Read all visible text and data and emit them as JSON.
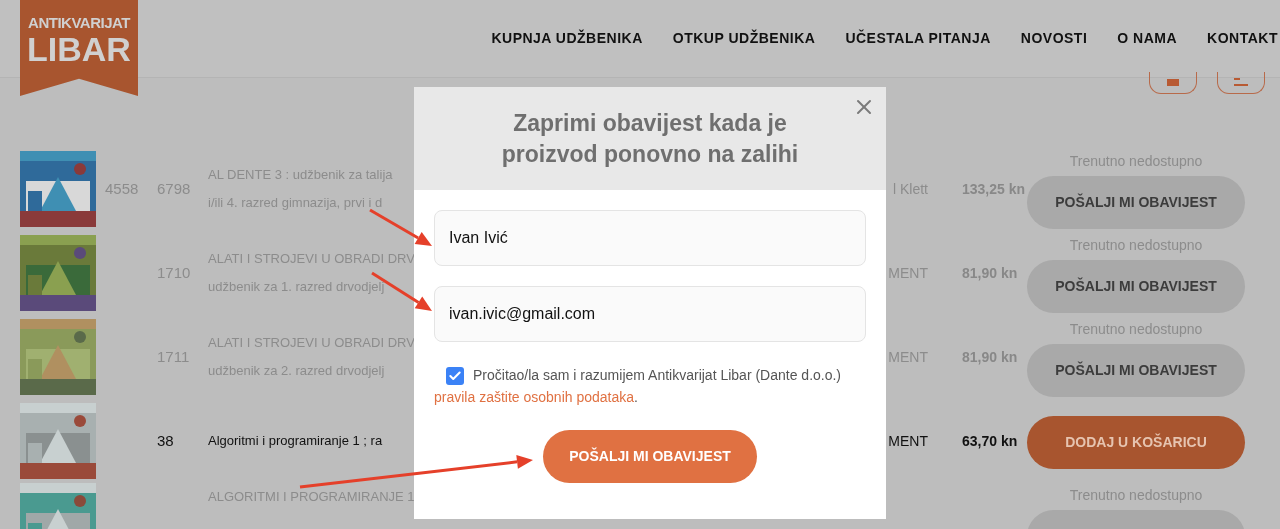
{
  "logo": {
    "small_text": "ANTIKVARIJAT",
    "name": "LIBAR"
  },
  "nav": [
    "KUPNJA UDŽBENIKA",
    "OTKUP UDŽBENIKA",
    "UČESTALA PITANJA",
    "NOVOSTI",
    "O NAMA",
    "KONTAKT"
  ],
  "rows": [
    {
      "code_1": "4558",
      "code_2": "6798",
      "title_lines": [
        "AL DENTE 3 : udžbenik za talija",
        "i/ili 4. razred gimnazija, prvi i d"
      ],
      "publisher": "l Klett",
      "price": "133,25 kn",
      "available": false,
      "status": "Trenutno nedostupno",
      "button": "POŠALJI MI OBAVIJEST"
    },
    {
      "code_2": "1710",
      "title_lines": [
        "ALATI I STROJEVI U OBRADI DRV",
        "udžbenik za 1. razred drvodjelj"
      ],
      "publisher": "MENT",
      "price": "81,90 kn",
      "available": false,
      "status": "Trenutno nedostupno",
      "button": "POŠALJI MI OBAVIJEST"
    },
    {
      "code_2": "1711",
      "title_lines": [
        "ALATI I STROJEVI U OBRADI DRV",
        "udžbenik za 2. razred drvodjelj"
      ],
      "publisher": "MENT",
      "price": "81,90 kn",
      "available": false,
      "status": "Trenutno nedostupno",
      "button": "POŠALJI MI OBAVIJEST"
    },
    {
      "code_2": "38",
      "title_lines": [
        "Algoritmi i programiranje 1 ; ra"
      ],
      "publisher": "MENT",
      "price": "63,70 kn",
      "available": true,
      "button": "DODAJ U KOŠARICU"
    },
    {
      "title_lines": [
        "ALGORITMI I PROGRAMIRANJE 1"
      ],
      "available": false,
      "status": "Trenutno nedostupno"
    }
  ],
  "modal": {
    "title": "Zaprimi obavijest kada je proizvod ponovno na zalihi",
    "fields": [
      {
        "value": "Ivan Ivić"
      },
      {
        "value": "ivan.ivic@gmail.com"
      }
    ],
    "consent": {
      "checked": true,
      "text": "Pročitao/la sam i razumijem Antikvarijat Libar (Dante d.o.o.)",
      "link": "pravila zaštite osobnih podataka",
      "end": "."
    },
    "submit": "POŠALJI MI OBAVIJEST"
  }
}
